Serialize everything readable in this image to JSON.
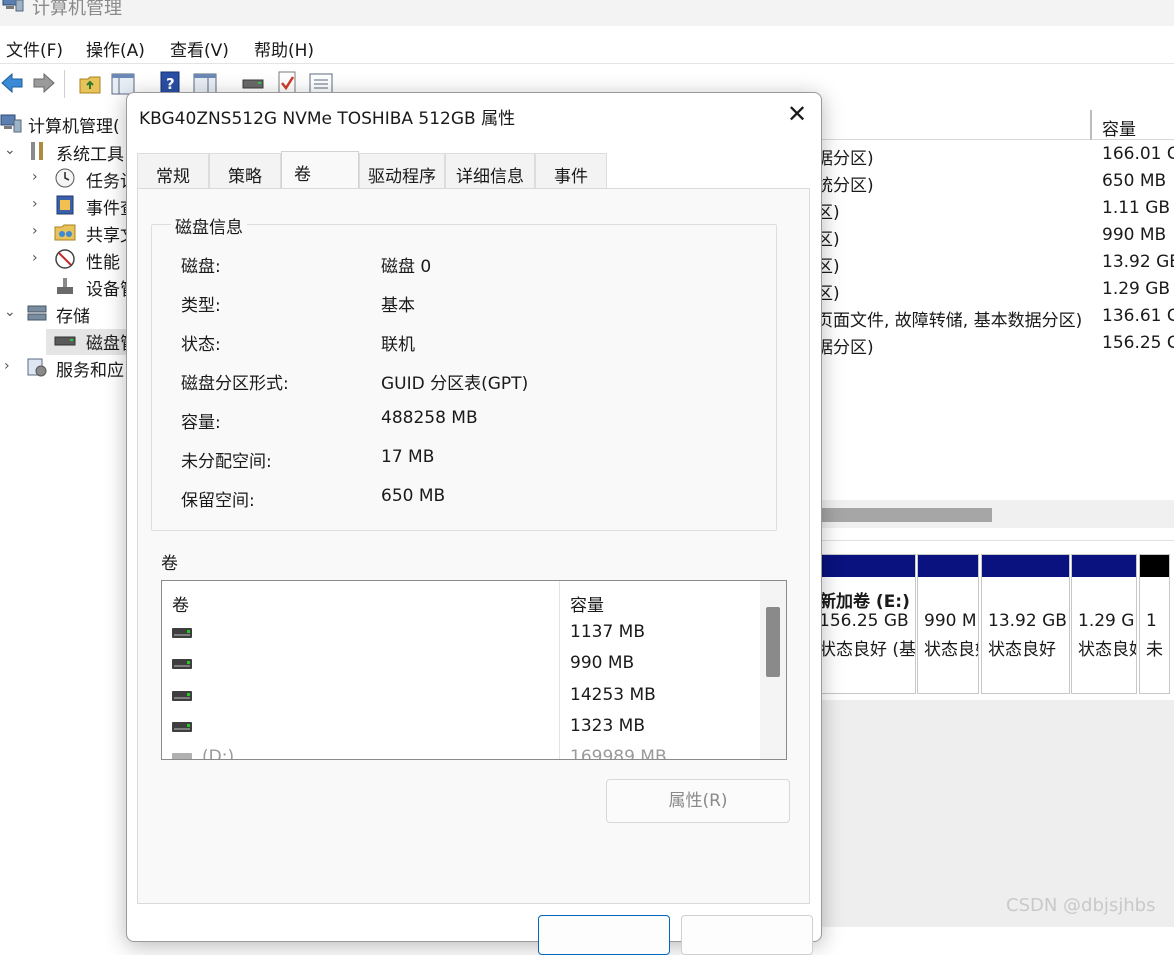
{
  "window": {
    "title": "计算机管理"
  },
  "menubar": [
    "文件(F)",
    "操作(A)",
    "查看(V)",
    "帮助(H)"
  ],
  "toolbar": {
    "icons": [
      "back-arrow-icon",
      "forward-arrow-icon",
      "up-folder-icon",
      "show-hide-tree-icon",
      "help-icon",
      "properties-pane-icon",
      "disk-icon",
      "check-document-icon",
      "list-properties-icon"
    ]
  },
  "tree": {
    "root": "计算机管理(",
    "system_tools": "系统工具",
    "task": "任务计",
    "event": "事件查",
    "shared": "共享文",
    "perf": "性能",
    "device": "设备管",
    "storage": "存储",
    "disk_mgmt": "磁盘管",
    "services": "服务和应"
  },
  "right_pane": {
    "capacity_header": "容量",
    "rows": [
      {
        "type": "据分区)",
        "capacity": "166.01 G"
      },
      {
        "type": "统分区)",
        "capacity": "650 MB"
      },
      {
        "type": "区)",
        "capacity": "1.11 GB"
      },
      {
        "type": "区)",
        "capacity": "990 MB"
      },
      {
        "type": "区)",
        "capacity": "13.92 GB"
      },
      {
        "type": "区)",
        "capacity": "1.29 GB"
      },
      {
        "type": "页面文件, 故障转储, 基本数据分区)",
        "capacity": "136.61 G"
      },
      {
        "type": "据分区)",
        "capacity": "156.25 G"
      }
    ],
    "partitions": [
      {
        "name": "新加卷 (E:)",
        "size": "156.25 GB",
        "status": "状态良好 (基"
      },
      {
        "name": "",
        "size": "990 MB",
        "status": "状态良好"
      },
      {
        "name": "",
        "size": "13.92 GB",
        "status": "状态良好"
      },
      {
        "name": "",
        "size": "1.29 GB",
        "status": "状态良好"
      },
      {
        "name": "",
        "size": "1",
        "status": "未"
      }
    ]
  },
  "watermark": "CSDN @dbjsjhbs",
  "dialog": {
    "title": "KBG40ZNS512G NVMe TOSHIBA 512GB 属性",
    "tabs": [
      "常规",
      "策略",
      "卷",
      "驱动程序",
      "详细信息",
      "事件"
    ],
    "active_tab": "卷",
    "disk_info": {
      "group_title": "磁盘信息",
      "items": [
        {
          "label": "磁盘:",
          "value": "磁盘 0"
        },
        {
          "label": "类型:",
          "value": "基本"
        },
        {
          "label": "状态:",
          "value": "联机"
        },
        {
          "label": "磁盘分区形式:",
          "value": "GUID 分区表(GPT)"
        },
        {
          "label": "容量:",
          "value": "488258 MB"
        },
        {
          "label": "未分配空间:",
          "value": "17 MB"
        },
        {
          "label": "保留空间:",
          "value": "650 MB"
        }
      ]
    },
    "volumes": {
      "heading": "卷",
      "col_volume": "卷",
      "col_capacity": "容量",
      "rows": [
        {
          "name": "",
          "capacity": "1137 MB"
        },
        {
          "name": "",
          "capacity": "990 MB"
        },
        {
          "name": "",
          "capacity": "14253 MB"
        },
        {
          "name": "",
          "capacity": "1323 MB"
        },
        {
          "name": "(D:)",
          "capacity": "169989 MB"
        }
      ]
    },
    "properties_button": "属性(R)"
  }
}
